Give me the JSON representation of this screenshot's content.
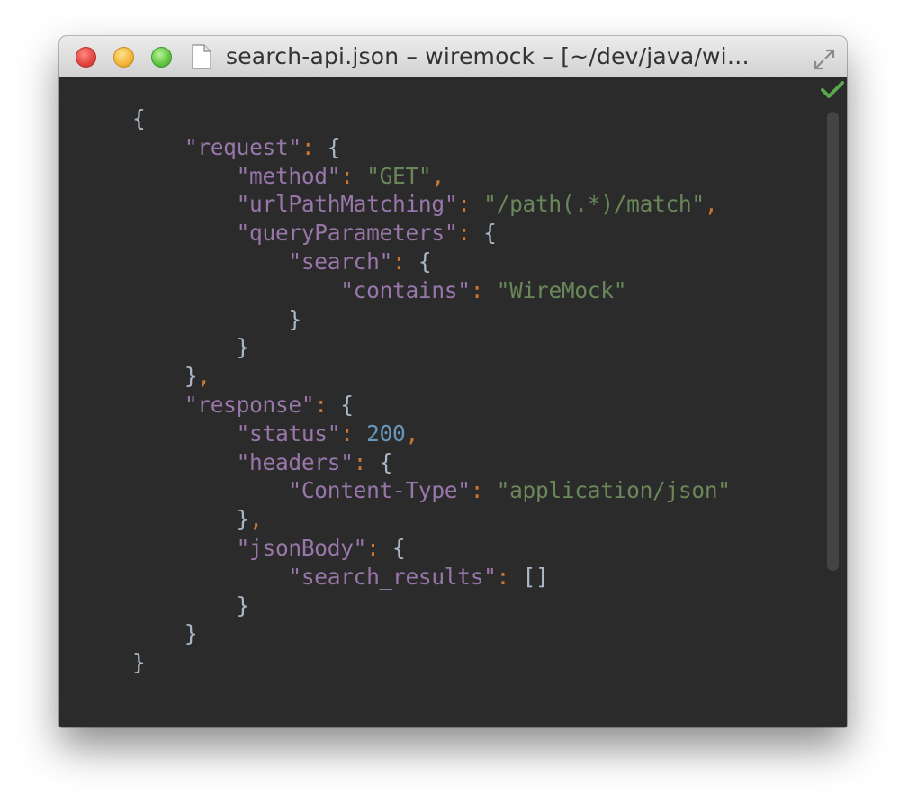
{
  "window": {
    "title": "search-api.json – wiremock – [~/dev/java/wi…",
    "traffic_lights": [
      "close",
      "minimize",
      "zoom"
    ],
    "icons": [
      "document-icon",
      "fullscreen-icon",
      "checkmark-icon"
    ]
  },
  "editor": {
    "status_check_color": "#59a84a",
    "code": {
      "open_root": "{",
      "request_key": "\"request\"",
      "method_key": "\"method\"",
      "method_value": "\"GET\"",
      "url_key": "\"urlPathMatching\"",
      "url_value": "\"/path(.*)/match\"",
      "query_key": "\"queryParameters\"",
      "search_key": "\"search\"",
      "contains_key": "\"contains\"",
      "contains_value": "\"WireMock\"",
      "response_key": "\"response\"",
      "status_key": "\"status\"",
      "status_value": "200",
      "headers_key": "\"headers\"",
      "content_type_key": "\"Content-Type\"",
      "content_type_value": "\"application/json\"",
      "json_body_key": "\"jsonBody\"",
      "search_results_key": "\"search_results\"",
      "search_results_value": "[]",
      "close_root": "}"
    }
  },
  "colors": {
    "background": "#2b2b2b",
    "key": "#9876aa",
    "string": "#6a8759",
    "number": "#6897bb",
    "punctuation": "#cc7832",
    "brace": "#a9b7c6"
  }
}
